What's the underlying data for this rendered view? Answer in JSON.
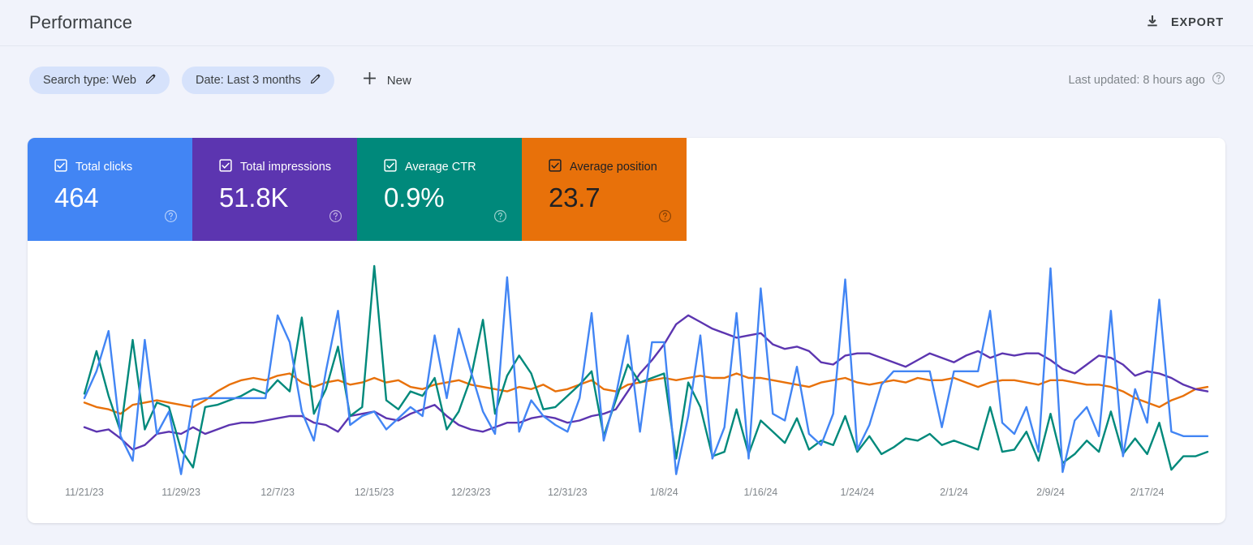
{
  "header": {
    "title": "Performance",
    "export_label": "EXPORT",
    "export_icon": "download-icon"
  },
  "filters": {
    "chips": [
      {
        "label": "Search type: Web",
        "icon": "pencil-icon"
      },
      {
        "label": "Date: Last 3 months",
        "icon": "pencil-icon"
      }
    ],
    "new_label": "New",
    "new_icon": "plus-icon",
    "last_updated": "Last updated: 8 hours ago",
    "help_icon": "help-circle-icon"
  },
  "metrics": [
    {
      "label": "Total clicks",
      "value": "464",
      "color": "#4285f4",
      "text": "light",
      "checked": true,
      "icon": "checkbox-checked-icon",
      "help_icon": "help-circle-icon"
    },
    {
      "label": "Total impressions",
      "value": "51.8K",
      "color": "#5c35b0",
      "text": "light",
      "checked": true,
      "icon": "checkbox-checked-icon",
      "help_icon": "help-circle-icon"
    },
    {
      "label": "Average CTR",
      "value": "0.9%",
      "color": "#00897b",
      "text": "light",
      "checked": true,
      "icon": "checkbox-checked-icon",
      "help_icon": "help-circle-icon"
    },
    {
      "label": "Average position",
      "value": "23.7",
      "color": "#e8710a",
      "text": "dark",
      "checked": true,
      "icon": "checkbox-checked-icon",
      "help_icon": "help-circle-icon"
    }
  ],
  "chart_data": {
    "type": "line",
    "title": "",
    "xlabel": "",
    "ylabel": "",
    "grid": false,
    "legend": "metric-tiles-above",
    "x_tick_labels": [
      "11/21/23",
      "11/29/23",
      "12/7/23",
      "12/15/23",
      "12/23/23",
      "12/31/23",
      "1/8/24",
      "1/16/24",
      "1/24/24",
      "2/1/24",
      "2/9/24",
      "2/17/24"
    ],
    "x_tick_indices": [
      0,
      8,
      16,
      24,
      32,
      40,
      48,
      56,
      64,
      72,
      80,
      88
    ],
    "n_points": 94,
    "ylim": [
      0,
      100
    ],
    "series": [
      {
        "name": "Total clicks",
        "color": "#4285f4",
        "values": [
          37,
          49,
          67,
          20,
          9,
          63,
          21,
          31,
          3,
          36,
          37,
          37,
          37,
          37,
          37,
          37,
          74,
          62,
          31,
          18,
          49,
          76,
          25,
          29,
          31,
          23,
          28,
          33,
          29,
          65,
          37,
          68,
          49,
          31,
          21,
          91,
          22,
          36,
          29,
          25,
          22,
          37,
          75,
          18,
          38,
          65,
          22,
          62,
          62,
          3,
          29,
          65,
          10,
          24,
          75,
          10,
          86,
          30,
          27,
          51,
          21,
          16,
          30,
          90,
          14,
          25,
          43,
          49,
          49,
          49,
          49,
          24,
          49,
          49,
          49,
          76,
          26,
          21,
          33,
          13,
          95,
          4,
          27,
          33,
          20,
          76,
          11,
          41,
          26,
          81,
          22,
          20,
          20,
          20
        ]
      },
      {
        "name": "Total impressions",
        "color": "#5c35b0",
        "values": [
          24,
          22,
          23,
          19,
          14,
          16,
          21,
          22,
          21,
          24,
          21,
          23,
          25,
          26,
          26,
          27,
          28,
          29,
          29,
          26,
          25,
          22,
          29,
          30,
          31,
          28,
          27,
          30,
          32,
          34,
          29,
          25,
          23,
          22,
          24,
          26,
          26,
          28,
          29,
          28,
          26,
          27,
          29,
          30,
          32,
          40,
          48,
          54,
          61,
          70,
          74,
          71,
          68,
          66,
          64,
          65,
          66,
          61,
          59,
          60,
          58,
          53,
          52,
          56,
          57,
          57,
          55,
          53,
          51,
          54,
          57,
          55,
          53,
          56,
          58,
          55,
          57,
          56,
          57,
          57,
          54,
          50,
          48,
          52,
          56,
          55,
          52,
          47,
          49,
          48,
          46,
          43,
          41,
          40
        ]
      },
      {
        "name": "Average CTR",
        "color": "#00897b",
        "values": [
          39,
          58,
          38,
          22,
          63,
          23,
          35,
          33,
          14,
          6,
          33,
          34,
          36,
          38,
          41,
          39,
          45,
          40,
          73,
          30,
          41,
          60,
          29,
          33,
          96,
          36,
          32,
          40,
          38,
          46,
          23,
          31,
          46,
          72,
          30,
          47,
          56,
          48,
          32,
          33,
          38,
          43,
          49,
          20,
          36,
          52,
          44,
          46,
          48,
          10,
          44,
          33,
          11,
          13,
          32,
          12,
          27,
          22,
          17,
          28,
          14,
          18,
          16,
          29,
          13,
          20,
          12,
          15,
          19,
          18,
          21,
          16,
          18,
          16,
          14,
          33,
          13,
          14,
          22,
          9,
          30,
          8,
          12,
          18,
          13,
          31,
          12,
          19,
          12,
          26,
          5,
          11,
          11,
          13
        ]
      },
      {
        "name": "Average position",
        "color": "#e8710a",
        "values": [
          35,
          33,
          32,
          30,
          34,
          35,
          36,
          35,
          34,
          33,
          36,
          40,
          43,
          45,
          46,
          45,
          47,
          48,
          44,
          42,
          44,
          45,
          43,
          44,
          46,
          44,
          45,
          42,
          41,
          43,
          44,
          45,
          43,
          42,
          41,
          40,
          42,
          41,
          43,
          40,
          41,
          43,
          45,
          41,
          40,
          43,
          44,
          45,
          46,
          45,
          46,
          47,
          46,
          46,
          48,
          46,
          46,
          45,
          44,
          43,
          42,
          44,
          45,
          46,
          44,
          43,
          44,
          45,
          44,
          46,
          45,
          45,
          46,
          44,
          42,
          44,
          45,
          45,
          44,
          43,
          45,
          45,
          44,
          43,
          43,
          42,
          40,
          37,
          35,
          33,
          36,
          38,
          41,
          42
        ]
      }
    ]
  }
}
